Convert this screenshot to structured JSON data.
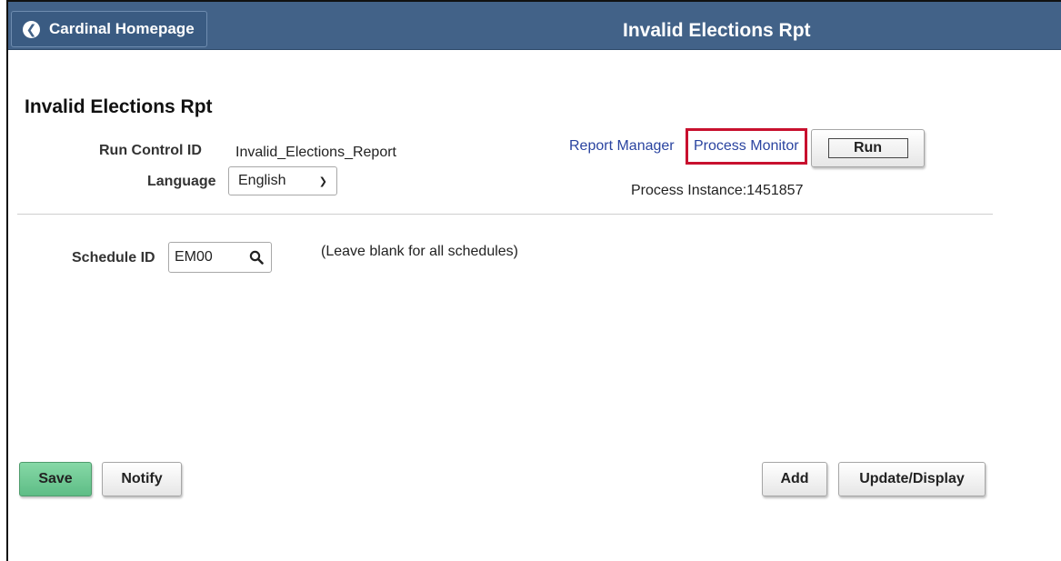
{
  "header": {
    "back_label": "Cardinal Homepage",
    "title": "Invalid Elections Rpt"
  },
  "page": {
    "title": "Invalid Elections Rpt"
  },
  "run_control": {
    "id_label": "Run Control ID",
    "id_value": "Invalid_Elections_Report",
    "language_label": "Language",
    "language_value": "English"
  },
  "process": {
    "report_manager_label": "Report Manager",
    "process_monitor_label": "Process Monitor",
    "run_label": "Run",
    "instance_text": "Process Instance:1451857",
    "highlight_color": "#c8102e"
  },
  "schedule": {
    "label": "Schedule ID",
    "value": "EM00",
    "hint": "(Leave blank for all schedules)"
  },
  "footer": {
    "save_label": "Save",
    "notify_label": "Notify",
    "add_label": "Add",
    "update_label": "Update/Display"
  },
  "colors": {
    "header_bg": "#426288",
    "save_bg": "#6fc995",
    "link": "#2a44a0"
  }
}
